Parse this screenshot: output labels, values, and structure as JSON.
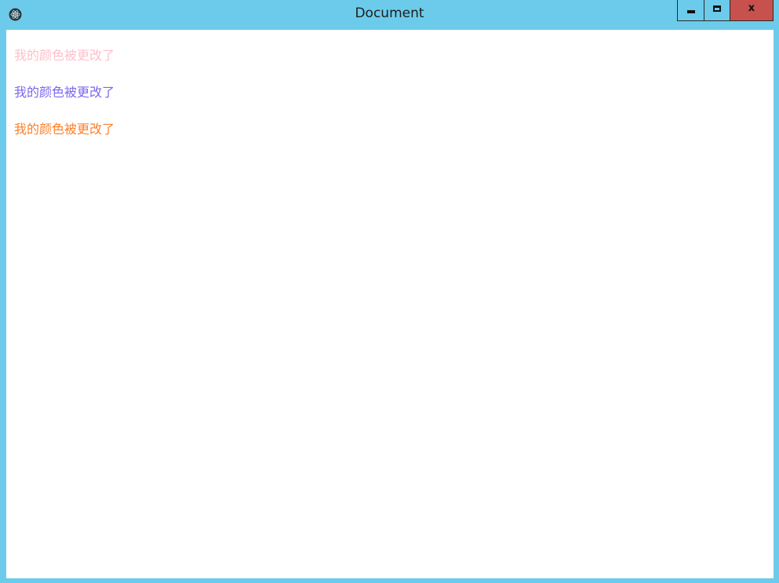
{
  "window": {
    "title": "Document",
    "close_glyph": "x",
    "icons": {
      "app": "electron-app-icon",
      "minimize": "minimize-icon",
      "maximize": "maximize-icon",
      "close": "close-icon"
    },
    "colors": {
      "frame": "#6ccbea",
      "close_button": "#c7514c"
    }
  },
  "content": {
    "lines": [
      {
        "text": "我的颜色被更改了",
        "color": "#ffc0cb"
      },
      {
        "text": "我的颜色被更改了",
        "color": "#7b68ee"
      },
      {
        "text": "我的颜色被更改了",
        "color": "#ff7f27"
      }
    ]
  }
}
